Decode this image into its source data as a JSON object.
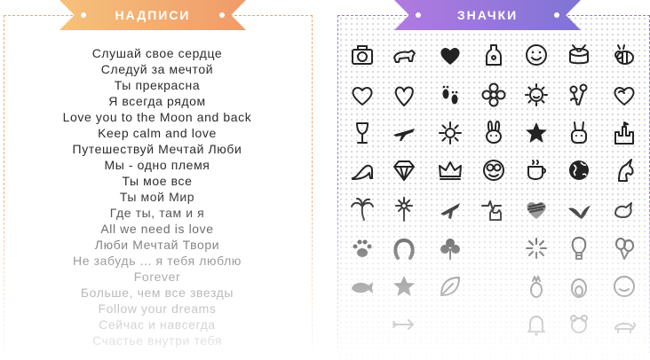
{
  "left_panel": {
    "title": "НАДПИСИ",
    "lines": [
      "Слушай свое сердце",
      "Следуй за мечтой",
      "Ты прекрасна",
      "Я всегда рядом",
      "Love you to the Moon and back",
      "Keep calm and love",
      "Путешествуй Мечтай Люби",
      "Мы - одно племя",
      "Ты мое все",
      "Ты мой Мир",
      "Где ты, там и я",
      "All we need is love",
      "Люби Мечтай Твори",
      "Не забудь ... я тебя люблю",
      "Forever",
      "Больше, чем все звезды",
      "Follow your dreams",
      "Сейчас и навсегда",
      "Счастье внутри тебя"
    ],
    "accent_colors": [
      "#f6c17b",
      "#f09b6a"
    ]
  },
  "right_panel": {
    "title": "ЗНАЧКИ",
    "icons": [
      "camera-icon",
      "polar-bear-icon",
      "heart-filled-icon",
      "bottle-icon",
      "smiley-icon",
      "drum-icon",
      "bee-icon",
      "heart-outline-icon",
      "heart-outline-2-icon",
      "footprints-icon",
      "flower-icon",
      "sun-face-icon",
      "flowers-icon",
      "heart-sketch-icon",
      "wine-glass-icon",
      "airplane-icon",
      "sun-icon",
      "bunny-icon",
      "star-face-icon",
      "bunny-2-icon",
      "castle-icon",
      "high-heel-icon",
      "diamond-icon",
      "crown-icon",
      "crazy-face-icon",
      "coffee-cup-icon",
      "globe-icon",
      "unicorn-icon",
      "palm-tree-icon",
      "daisy-icon",
      "plane-icon",
      "heartbeat-cat-icon",
      "scribble-heart-icon",
      "bird-icon",
      "bird-outline-icon",
      "paw-icon",
      "horseshoe-icon",
      "clover-icon",
      "empty-icon",
      "fireworks-icon",
      "hot-air-balloon-icon",
      "balloons-icon",
      "whale-icon",
      "star-icon",
      "leaf-icon",
      "empty-icon",
      "pineapple-icon",
      "penguin-icon",
      "smile-icon",
      "empty-icon",
      "arrow-icon",
      "empty-icon",
      "empty-icon",
      "bell-icon",
      "teddy-icon",
      "turtle-icon"
    ],
    "accent_colors": [
      "#b17ae0",
      "#7f74d6"
    ]
  }
}
